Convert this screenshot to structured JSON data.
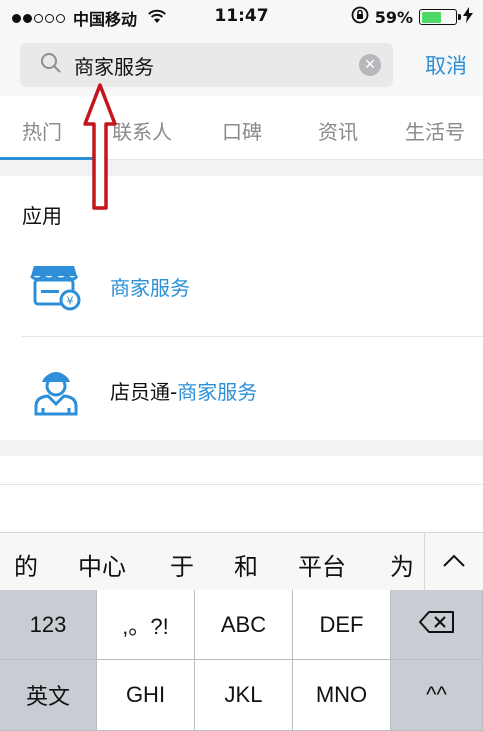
{
  "status_bar": {
    "carrier": "中国移动",
    "time": "11:47",
    "battery_percent": "59%",
    "battery_level": 0.59,
    "signal_dots_filled": 2,
    "signal_dots_total": 5
  },
  "search": {
    "query": "商家服务",
    "cancel_label": "取消"
  },
  "tabs": [
    "热门",
    "联系人",
    "口碑",
    "资讯",
    "生活号"
  ],
  "active_tab": "热门",
  "results": {
    "section_title": "应用",
    "items": [
      {
        "label": "商家服务",
        "icon": "storefront-icon"
      },
      {
        "label_prefix": "店员通-",
        "label_highlight": "商家服务",
        "icon": "clerk-icon"
      }
    ]
  },
  "keyboard": {
    "candidates": [
      "的",
      "中心",
      "于",
      "和",
      "平台",
      "为"
    ],
    "row1": [
      "123",
      ",。?!",
      "ABC",
      "DEF"
    ],
    "row2": [
      "英文",
      "GHI",
      "JKL",
      "MNO",
      "^^"
    ]
  },
  "colors": {
    "accent": "#2c8fd8",
    "annotation_arrow": "#c4161c"
  }
}
